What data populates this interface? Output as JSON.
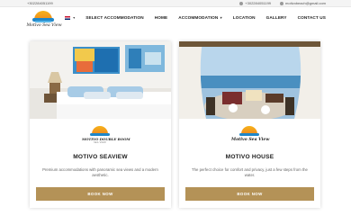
{
  "topbar": {
    "phone_left": "+302284051199",
    "phone_right": "+302284051199",
    "email": "motivobeach@gmail.com"
  },
  "logo": {
    "text": "Motivo Sea View"
  },
  "nav": {
    "language": "EN",
    "items": [
      {
        "label": "SELECT ACCOMMODATION",
        "has_dropdown": false
      },
      {
        "label": "HOME",
        "has_dropdown": false
      },
      {
        "label": "ACCOMMODATION",
        "has_dropdown": true
      },
      {
        "label": "LOCATION",
        "has_dropdown": false
      },
      {
        "label": "GALLERY",
        "has_dropdown": false
      },
      {
        "label": "CONTACT US",
        "has_dropdown": false
      }
    ]
  },
  "cards": [
    {
      "logo_title": "MOTIVO DOUBLE ROOM",
      "logo_sub": "SEA VIEW",
      "title": "MOTIVO SEAVIEW",
      "description": "Premium accommodations with panoramic sea views and a modern aesthetic.",
      "button": "BOOK NOW"
    },
    {
      "logo_title": "Motivo Sea View",
      "logo_sub": "",
      "title": "MOTIVO HOUSE",
      "description": "The perfect choice for comfort and privacy, just a few steps from the water.",
      "button": "BOOK NOW"
    }
  ],
  "colors": {
    "accent_button": "#b49257",
    "logo_sun": "#f6b21b",
    "logo_wave": "#1f86c8"
  }
}
